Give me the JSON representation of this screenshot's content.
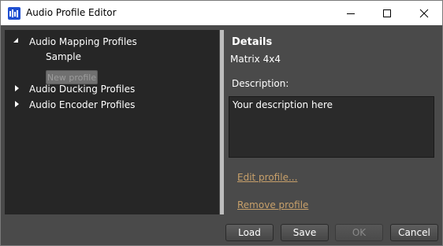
{
  "window": {
    "title": "Audio Profile Editor",
    "icon": "audio-bars-icon",
    "controls": [
      "minimize-icon",
      "maximize-icon",
      "close-icon"
    ]
  },
  "tree": {
    "groups": [
      {
        "label": "Audio Mapping Profiles",
        "expanded": true,
        "children": [
          {
            "label": "Sample"
          }
        ],
        "new_button_label": "New profile"
      },
      {
        "label": "Audio Ducking Profiles",
        "expanded": false
      },
      {
        "label": "Audio Encoder Profiles",
        "expanded": false
      }
    ]
  },
  "details": {
    "heading": "Details",
    "name": "Matrix 4x4",
    "description_label": "Description:",
    "description_value": "Your description here",
    "edit_link": "Edit profile...",
    "remove_link": "Remove profile"
  },
  "buttons": {
    "load": "Load",
    "save": "Save",
    "ok": "OK",
    "cancel": "Cancel"
  }
}
